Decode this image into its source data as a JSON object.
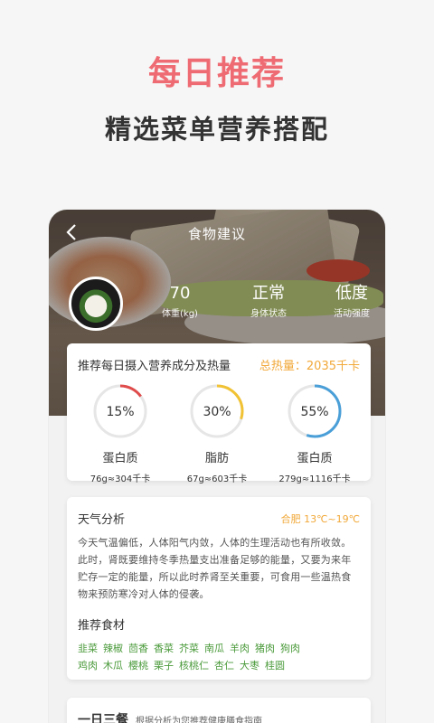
{
  "promo": {
    "title": "每日推荐",
    "subtitle": "精选菜单营养搭配"
  },
  "nav": {
    "title": "食物建议",
    "back_icon": "chevron-left-icon"
  },
  "stats": [
    {
      "value": "70",
      "label": "体重(kg)"
    },
    {
      "value": "正常",
      "label": "身体状态"
    },
    {
      "value": "低度",
      "label": "活动强度"
    }
  ],
  "nutrition": {
    "title": "推荐每日摄入营养成分及热量",
    "total": "总热量：2035千卡",
    "items": [
      {
        "percent": 15,
        "percent_label": "15%",
        "name": "蛋白质",
        "kcal": "76g≈304千卡",
        "color": "#e04b4b"
      },
      {
        "percent": 30,
        "percent_label": "30%",
        "name": "脂肪",
        "kcal": "67g≈603千卡",
        "color": "#f1c233"
      },
      {
        "percent": 55,
        "percent_label": "55%",
        "name": "蛋白质",
        "kcal": "279g≈1116千卡",
        "color": "#4a9fd8"
      }
    ]
  },
  "weather": {
    "title": "天气分析",
    "info": "合肥  13℃~19℃",
    "desc": "今天气温偏低，人体阳气内敛，人体的生理活动也有所收敛。此时，肾既要维持冬季热量支出准备足够的能量，又要为来年贮存一定的能量，所以此时养肾至关重要，可食用一些温热食物来预防寒冷对人体的侵袭。"
  },
  "foods": {
    "title": "推荐食材",
    "items": [
      "韭菜",
      "辣椒",
      "茴香",
      "香菜",
      "芥菜",
      "南瓜",
      "羊肉",
      "猪肉",
      "狗肉",
      "鸡肉",
      "木瓜",
      "樱桃",
      "栗子",
      "核桃仁",
      "杏仁",
      "大枣",
      "桂圆"
    ]
  },
  "meals": {
    "title": "一日三餐",
    "subtitle": "根据分析为您推荐健康膳食指南"
  },
  "colors": {
    "accent": "#ef6b73",
    "orange": "#f1a839",
    "green": "#4a9a3a"
  }
}
